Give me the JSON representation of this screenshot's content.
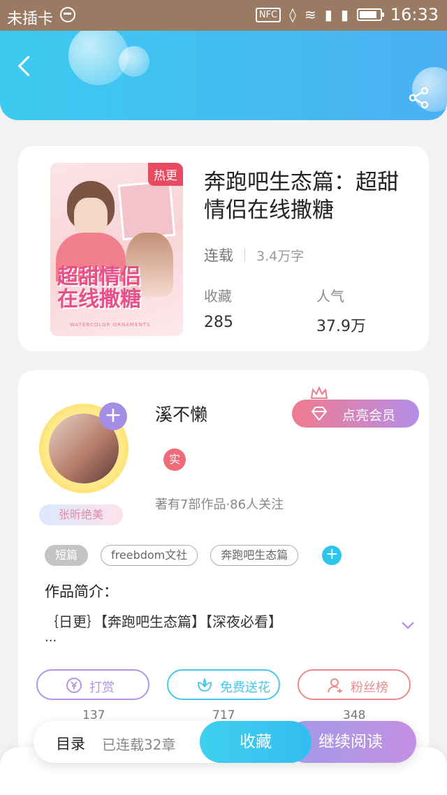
{
  "status_bar": {
    "carrier": "未插卡",
    "nfc": "NFC",
    "time": "16:33"
  },
  "book": {
    "badge": "热更",
    "title": "奔跑吧生态篇：超甜情侣在线撒糖",
    "cover_text": "超甜情侣在线撒糖",
    "cover_footer": "WATERCOLOR ORNAMENTS",
    "status": "连载",
    "word_count": "3.4万字",
    "stats": [
      {
        "label": "收藏",
        "value": "285"
      },
      {
        "label": "人气",
        "value": "37.9万"
      }
    ]
  },
  "author": {
    "name": "溪不懒",
    "vip_label": "点亮会员",
    "verified_label": "实",
    "fan_tag": "张昕绝美",
    "stats_line": "著有7部作品·86人关注",
    "tags": [
      "短篇",
      "freebdom文社",
      "奔跑吧生态篇"
    ],
    "intro_label": "作品简介：",
    "intro_text": "｛日更｝【奔跑吧生态篇】【深夜必看】",
    "intro_ellipsis": "...",
    "actions": [
      {
        "label": "打赏",
        "count": "137",
        "color": "#b394e6"
      },
      {
        "label": "免费送花",
        "count": "717",
        "color": "#45c9e8"
      },
      {
        "label": "粉丝榜",
        "count": "348",
        "color": "#ee8a8e"
      }
    ]
  },
  "bottom_bar": {
    "toc": "目录",
    "chapters": "已连载32章",
    "collect": "收藏",
    "read": "继续阅读"
  },
  "colors": {
    "header": "#3ccbef",
    "hot_badge": "#e84a5f",
    "vip_gradient_start": "#f07b8f",
    "vip_gradient_end": "#b48ee8",
    "accent_blue": "#2cc5ec"
  }
}
